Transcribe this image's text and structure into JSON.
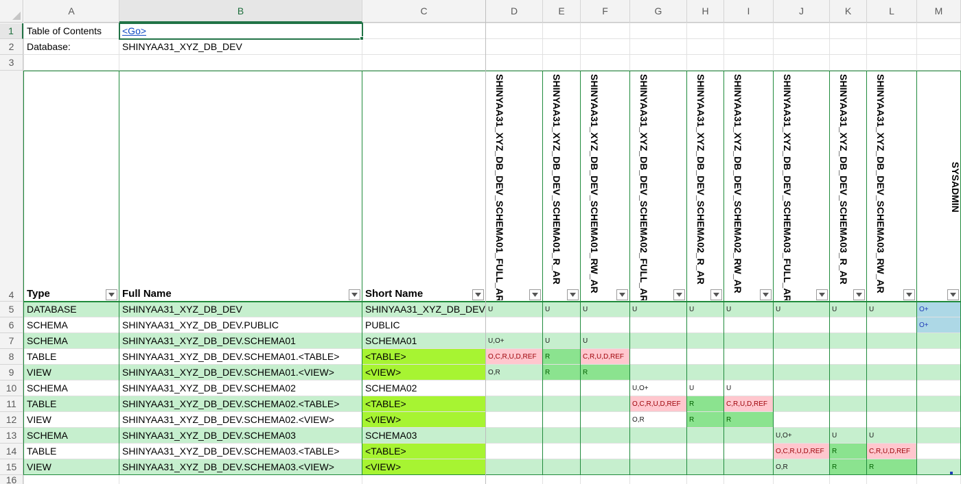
{
  "columns": [
    "A",
    "B",
    "C",
    "D",
    "E",
    "F",
    "G",
    "H",
    "I",
    "J",
    "K",
    "L",
    "M"
  ],
  "selected_column": "B",
  "selected_row": "1",
  "rows": [
    "1",
    "2",
    "3",
    "4",
    "5",
    "6",
    "7",
    "8",
    "9",
    "10",
    "11",
    "12",
    "13",
    "14",
    "15",
    "16"
  ],
  "toc": {
    "label": "Table of Contents",
    "link": "<Go>"
  },
  "database": {
    "label": "Database:",
    "value": "SHINYAA31_XYZ_DB_DEV"
  },
  "headers": {
    "type": "Type",
    "full_name": "Full Name",
    "short_name": "Short Name",
    "roles": [
      "SHINYAA31_XYZ_DB_DEV_SCHEMA01_FULL_AR",
      "SHINYAA31_XYZ_DB_DEV_SCHEMA01_R_AR",
      "SHINYAA31_XYZ_DB_DEV_SCHEMA01_RW_AR",
      "SHINYAA31_XYZ_DB_DEV_SCHEMA02_FULL_AR",
      "SHINYAA31_XYZ_DB_DEV_SCHEMA02_R_AR",
      "SHINYAA31_XYZ_DB_DEV_SCHEMA02_RW_AR",
      "SHINYAA31_XYZ_DB_DEV_SCHEMA03_FULL_AR",
      "SHINYAA31_XYZ_DB_DEV_SCHEMA03_R_AR",
      "SHINYAA31_XYZ_DB_DEV_SCHEMA03_RW_AR",
      "SYSADMIN"
    ]
  },
  "data_rows": [
    {
      "type": "DATABASE",
      "full": "SHINYAA31_XYZ_DB_DEV",
      "short": "SHINYAA31_XYZ_DB_DEV",
      "perms": [
        "U",
        "U",
        "U",
        "U",
        "U",
        "U",
        "U",
        "U",
        "U",
        "O+"
      ]
    },
    {
      "type": "SCHEMA",
      "full": "SHINYAA31_XYZ_DB_DEV.PUBLIC",
      "short": "PUBLIC",
      "perms": [
        "",
        "",
        "",
        "",
        "",
        "",
        "",
        "",
        "",
        "O+"
      ]
    },
    {
      "type": "SCHEMA",
      "full": "SHINYAA31_XYZ_DB_DEV.SCHEMA01",
      "short": "SCHEMA01",
      "perms": [
        "U,O+",
        "U",
        "U",
        "",
        "",
        "",
        "",
        "",
        "",
        ""
      ]
    },
    {
      "type": "TABLE",
      "full": "SHINYAA31_XYZ_DB_DEV.SCHEMA01.<TABLE>",
      "short": "<TABLE>",
      "perms": [
        "O,C,R,U,D,REF",
        "R",
        "C,R,U,D,REF",
        "",
        "",
        "",
        "",
        "",
        "",
        ""
      ]
    },
    {
      "type": "VIEW",
      "full": "SHINYAA31_XYZ_DB_DEV.SCHEMA01.<VIEW>",
      "short": "<VIEW>",
      "perms": [
        "O,R",
        "R",
        "R",
        "",
        "",
        "",
        "",
        "",
        "",
        ""
      ]
    },
    {
      "type": "SCHEMA",
      "full": "SHINYAA31_XYZ_DB_DEV.SCHEMA02",
      "short": "SCHEMA02",
      "perms": [
        "",
        "",
        "",
        "U,O+",
        "U",
        "U",
        "",
        "",
        "",
        ""
      ]
    },
    {
      "type": "TABLE",
      "full": "SHINYAA31_XYZ_DB_DEV.SCHEMA02.<TABLE>",
      "short": "<TABLE>",
      "perms": [
        "",
        "",
        "",
        "O,C,R,U,D,REF",
        "R",
        "C,R,U,D,REF",
        "",
        "",
        "",
        ""
      ]
    },
    {
      "type": "VIEW",
      "full": "SHINYAA31_XYZ_DB_DEV.SCHEMA02.<VIEW>",
      "short": "<VIEW>",
      "perms": [
        "",
        "",
        "",
        "O,R",
        "R",
        "R",
        "",
        "",
        "",
        ""
      ]
    },
    {
      "type": "SCHEMA",
      "full": "SHINYAA31_XYZ_DB_DEV.SCHEMA03",
      "short": "SCHEMA03",
      "perms": [
        "",
        "",
        "",
        "",
        "",
        "",
        "U,O+",
        "U",
        "U",
        ""
      ]
    },
    {
      "type": "TABLE",
      "full": "SHINYAA31_XYZ_DB_DEV.SCHEMA03.<TABLE>",
      "short": "<TABLE>",
      "perms": [
        "",
        "",
        "",
        "",
        "",
        "",
        "O,C,R,U,D,REF",
        "R",
        "C,R,U,D,REF",
        ""
      ]
    },
    {
      "type": "VIEW",
      "full": "SHINYAA31_XYZ_DB_DEV.SCHEMA03.<VIEW>",
      "short": "<VIEW>",
      "perms": [
        "",
        "",
        "",
        "",
        "",
        "",
        "O,R",
        "R",
        "R",
        ""
      ]
    }
  ],
  "colors": {
    "row_band": "#c6efce",
    "short_name_highlight": "#a7f432",
    "owner_perm": "#ffc7ce",
    "read_perm": "#8be38f",
    "sysadmin_perm": "#add8e6",
    "border_green": "#1f8a3b"
  },
  "icons": {
    "filter_button": "dropdown-arrow-icon",
    "corner": "select-all-triangle-icon"
  }
}
